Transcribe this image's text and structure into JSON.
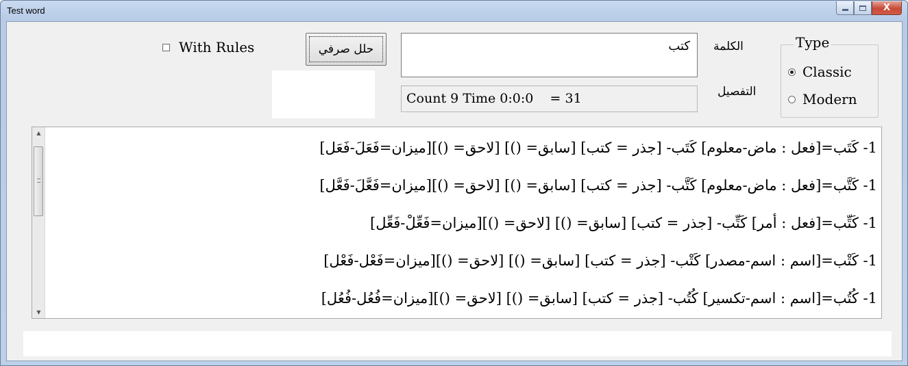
{
  "window": {
    "title": "Test word",
    "buttons": {
      "minimize": "minimize",
      "maximize": "maximize",
      "close": "X"
    }
  },
  "type_group": {
    "legend": "Type",
    "options": [
      {
        "label": "Classic",
        "selected": true
      },
      {
        "label": "Modern",
        "selected": false
      }
    ]
  },
  "labels": {
    "word": "الكلمة",
    "details": "التفصيل"
  },
  "word_input": {
    "value": "كتب"
  },
  "details_field": {
    "value": "Count 9 Time 0:0:0    = 31"
  },
  "analyze_button": {
    "label": "حلل صرفي"
  },
  "rules_checkbox": {
    "label": "With Rules",
    "checked": false
  },
  "results": {
    "lines": [
      "1- كَتَب=[فعل : ماض-معلوم] كَتَب-  [جذر = كتب]  [سابق= ()]  [لاحق= ()][ميزان=فَعَلَ-فَعَل]",
      "1- كَتَّب=[فعل : ماض-معلوم] كَتَّب-  [جذر = كتب]  [سابق= ()]  [لاحق= ()][ميزان=فَعَّلَ-فَعَّل]",
      "1- كَتِّب=[فعل : أمر] كَتِّب-  [جذر = كتب]  [سابق= ()]  [لاحق= ()][ميزان=فَعِّلْ-فَعِّل]",
      "1- كَتْب=[اسم : اسم-مصدر] كَتْب-  [جذر = كتب]  [سابق= ()]  [لاحق= ()][ميزان=فَعْل-فَعْل]",
      "1- كُتُب=[اسم : اسم-تكسير] كُتُب-  [جذر = كتب]  [سابق= ()]  [لاحق= ()][ميزان=فُعُل-فُعُل]"
    ]
  }
}
